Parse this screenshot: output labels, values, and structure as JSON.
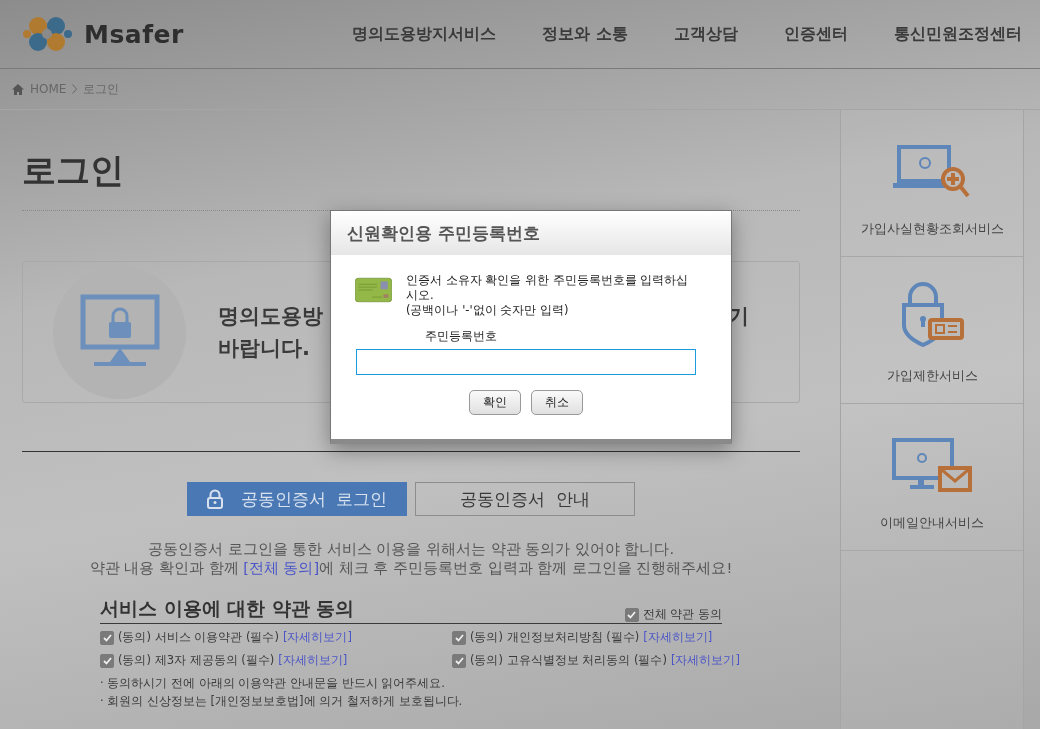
{
  "header": {
    "logo": "Msafer",
    "nav": [
      "명의도용방지서비스",
      "정보와 소통",
      "고객상담",
      "인증센터",
      "통신민원조정센터"
    ]
  },
  "breadcrumb": {
    "home": "HOME",
    "current": "로그인"
  },
  "page_title": "로그인",
  "notice_card": {
    "line_1": "명의도용방",
    "line_1_end": "기",
    "line_2": "바랍니다."
  },
  "login_tabs": [
    {
      "label": "공동인증서  로그인",
      "selected": true
    },
    {
      "label": "공동인증서  안내",
      "selected": false
    }
  ],
  "intro": {
    "line_1": "공동인증서 로그인을 통한 서비스 이용을 위해서는 약관 동의가 있어야 합니다.",
    "line_2_before": "약관 내용 확인과 함께 ",
    "line_2_link": "[전체 동의]",
    "line_2_after": "에 체크 후 주민등록번호 입력과 함께 로그인을 진행해주세요!"
  },
  "terms": {
    "title": "서비스 이용에 대한 약관 동의",
    "agree_all": {
      "label": "전체 약관 동의",
      "checked": true
    },
    "items": [
      {
        "label": "(동의) 서비스 이용약관 (필수)",
        "link": "[자세히보기]",
        "checked": true
      },
      {
        "label": "(동의) 개인정보처리방침 (필수)",
        "link": "[자세히보기]",
        "checked": true
      },
      {
        "label": "(동의) 제3자 제공동의 (필수)",
        "link": "[자세히보기]",
        "checked": true
      },
      {
        "label": "(동의) 고유식별정보 처리동의 (필수)",
        "link": "[자세히보기]",
        "checked": true
      }
    ],
    "notes": [
      "· 동의하시기 전에 아래의 이용약관 안내문을 반드시 읽어주세요.",
      "· 회원의 신상정보는 [개인정보보호법]에 의거 철저하게 보호됩니다."
    ]
  },
  "sidebar": {
    "items": [
      {
        "kind": "search",
        "label": "가입사실현황조회서비스"
      },
      {
        "kind": "lock",
        "label": "가입제한서비스"
      },
      {
        "kind": "mail",
        "label": "이메일안내서비스"
      }
    ]
  },
  "dialog": {
    "title": "신원확인용 주민등록번호",
    "message": "인증서 소유자 확인을 위한 주민등록번호를 입력하십시오.",
    "hint": "(공백이나 '-'없이 숫자만 입력)",
    "field_label": "주민등록번호",
    "buttons": [
      "확인",
      "취소"
    ]
  }
}
